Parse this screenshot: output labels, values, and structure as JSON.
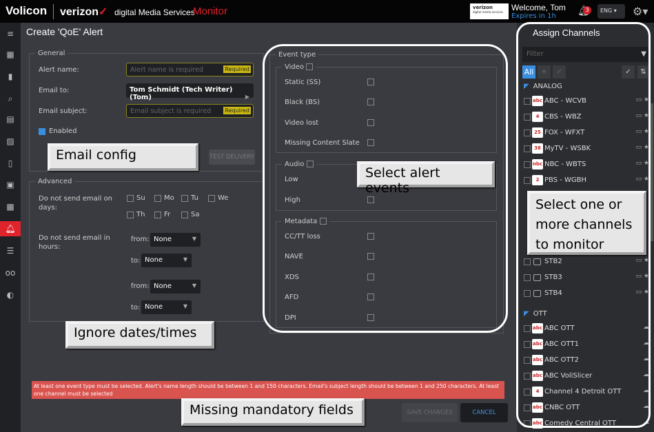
{
  "header": {
    "brand": "Volicon",
    "partner": "verizon",
    "partner_suffix": "digital Media Services",
    "product": "Monitor",
    "partner_badge": "verizon",
    "partner_badge_sub": "digital media services",
    "welcome": "Welcome, Tom",
    "expires": "Expires in 1h",
    "notifications": "3",
    "language": "ENG"
  },
  "page": {
    "title": "Create 'QoE' Alert"
  },
  "general": {
    "legend": "General",
    "alert_name_label": "Alert name:",
    "alert_name_placeholder": "Alert name is required",
    "required": "Required",
    "email_to_label": "Email to:",
    "email_to_value": "Tom Schmidt (Tech Writer) (Tom)",
    "email_subject_label": "Email subject:",
    "email_subject_placeholder": "Email subject is required",
    "enabled_label": "Enabled",
    "enabled": true,
    "test_delivery": "TEST DELIVERY"
  },
  "advanced": {
    "legend": "Advanced",
    "days_label": "Do not send email on days:",
    "days": [
      "Su",
      "Mo",
      "Tu",
      "We",
      "Th",
      "Fr",
      "Sa"
    ],
    "hours_label": "Do not send email in hours:",
    "from": "from:",
    "to": "to:",
    "none": "None"
  },
  "events": {
    "legend": "Event type",
    "video": {
      "label": "Video",
      "items": [
        "Static (SS)",
        "Black (BS)",
        "Video lost",
        "Missing Content Slate"
      ]
    },
    "audio": {
      "label": "Audio",
      "items": [
        "Low",
        "High"
      ]
    },
    "metadata": {
      "label": "Metadata",
      "items": [
        "CC/TT loss",
        "NAVE",
        "XDS",
        "AFD",
        "DPI"
      ]
    }
  },
  "error": "At least one event type must be selected. Alert's name length should be between 1 and 150 characters. Email's subject length should be between 1 and 250 characters. At least one channel must be selected",
  "actions": {
    "save": "SAVE CHANGES",
    "cancel": "CANCEL"
  },
  "channels": {
    "title": "Assign Channels",
    "filter_placeholder": "Filter",
    "all": "All",
    "analog": {
      "label": "ANALOG",
      "items": [
        {
          "name": "ABC - WCVB",
          "logo": "abc"
        },
        {
          "name": "CBS - WBZ",
          "logo": "4"
        },
        {
          "name": "FOX - WFXT",
          "logo": "25"
        },
        {
          "name": "MyTV - WSBK",
          "logo": "38"
        },
        {
          "name": "NBC - WBTS",
          "logo": "nbc"
        },
        {
          "name": "PBS - WGBH",
          "logo": "2"
        }
      ]
    },
    "stb": [
      "STB2",
      "STB3",
      "STB4"
    ],
    "ott": {
      "label": "OTT",
      "items": [
        "ABC OTT",
        "ABC OTT1",
        "ABC OTT2",
        "ABC VoliSlicer",
        "Channel 4 Detroit OTT",
        "CNBC OTT",
        "Comedy Central OTT"
      ]
    }
  },
  "annotations": {
    "email": "Email config",
    "events": "Select alert events",
    "channels": "Select one or more channels to monitor",
    "ignore": "Ignore dates/times",
    "missing": "Missing mandatory fields"
  },
  "colors": {
    "accent": "#3a8ee0",
    "error": "#d9534f",
    "brand_red": "#e0202a",
    "required": "#c9b814"
  }
}
